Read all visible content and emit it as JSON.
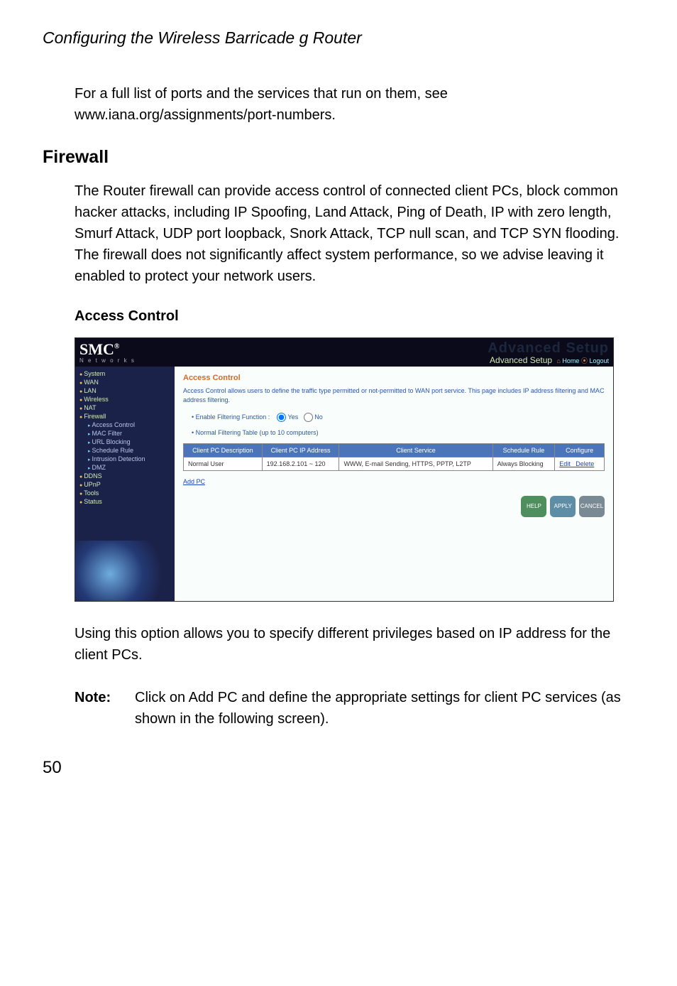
{
  "doc_header": "Configuring the Wireless Barricade g Router",
  "intro_para": "For a full list of ports and the services that run on them, see www.iana.org/assignments/port-numbers.",
  "section_firewall": "Firewall",
  "firewall_para": "The Router firewall can provide access control of connected client PCs, block common hacker attacks, including IP Spoofing, Land Attack, Ping of Death, IP with zero length, Smurf Attack, UDP port loopback, Snork Attack, TCP null scan, and TCP SYN flooding. The firewall does not significantly affect system performance, so we advise leaving it enabled to protect your network users.",
  "section_access": "Access Control",
  "logo_brand": "SMC",
  "logo_reg": "®",
  "logo_sub": "N e t w o r k s",
  "topbar_faint": "Advanced Setup",
  "topbar_advanced": "Advanced Setup",
  "topbar_home": "Home",
  "topbar_logout": "Logout",
  "nav": {
    "items": [
      {
        "label": "System",
        "type": "top"
      },
      {
        "label": "WAN",
        "type": "top"
      },
      {
        "label": "LAN",
        "type": "top"
      },
      {
        "label": "Wireless",
        "type": "top"
      },
      {
        "label": "NAT",
        "type": "top"
      },
      {
        "label": "Firewall",
        "type": "top"
      },
      {
        "label": "Access Control",
        "type": "sub"
      },
      {
        "label": "MAC Filter",
        "type": "sub"
      },
      {
        "label": "URL Blocking",
        "type": "sub"
      },
      {
        "label": "Schedule Rule",
        "type": "sub"
      },
      {
        "label": "Intrusion Detection",
        "type": "sub"
      },
      {
        "label": "DMZ",
        "type": "sub"
      },
      {
        "label": "DDNS",
        "type": "top"
      },
      {
        "label": "UPnP",
        "type": "top"
      },
      {
        "label": "Tools",
        "type": "top"
      },
      {
        "label": "Status",
        "type": "top"
      }
    ]
  },
  "panel": {
    "title": "Access Control",
    "desc": "Access Control allows users to define the traffic type permitted or not-permitted to WAN port service. This page includes IP address filtering and MAC address filtering.",
    "enable_label": "Enable Filtering Function :",
    "yes": "Yes",
    "no": "No",
    "table_title": "Normal Filtering Table (up to 10 computers)",
    "headers": [
      "Client PC Description",
      "Client PC IP Address",
      "Client Service",
      "Schedule Rule",
      "Configure"
    ],
    "row": {
      "desc": "Normal User",
      "ip": "192.168.2.101 ~ 120",
      "service": "WWW, E-mail Sending, HTTPS, PPTP, L2TP",
      "rule": "Always Blocking",
      "edit": "Edit",
      "delete": "Delete"
    },
    "add_pc": "Add PC",
    "help": "HELP",
    "apply": "APPLY",
    "cancel": "CANCEL"
  },
  "below_para": "Using this option allows you to specify different privileges based on IP address for the client PCs.",
  "note_label": "Note:",
  "note_text": "Click on Add PC and define the appropriate settings for client PC services (as shown in the following screen).",
  "page_num": "50"
}
